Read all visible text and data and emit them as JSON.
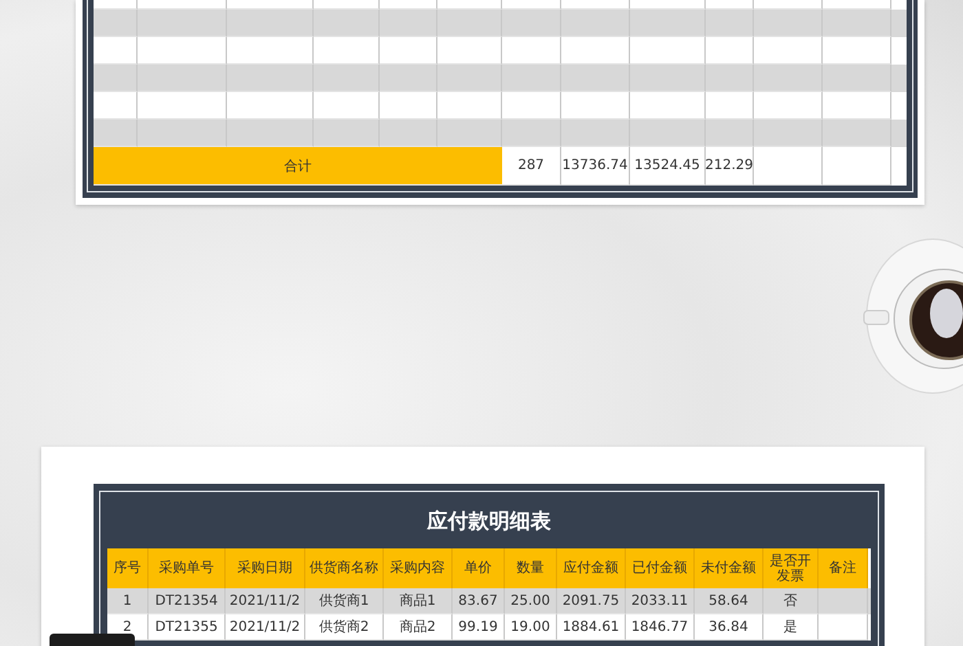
{
  "upper_sheet": {
    "rows": [
      {
        "shaded": false
      },
      {
        "shaded": true
      },
      {
        "shaded": false
      },
      {
        "shaded": true
      },
      {
        "shaded": false
      },
      {
        "shaded": true
      }
    ],
    "total_row": {
      "label": "合计",
      "values": [
        "287",
        "13736.74",
        "13524.45",
        "212.29"
      ]
    }
  },
  "lower_sheet": {
    "title": "应付款明细表",
    "columns": [
      "序号",
      "采购单号",
      "采购日期",
      "供货商名称",
      "采购内容",
      "单价",
      "数量",
      "应付金额",
      "已付金额",
      "未付金额",
      "是否开发票",
      "备注"
    ],
    "rows": [
      {
        "shaded": true,
        "cells": [
          "1",
          "DT21354",
          "2021/11/2",
          "供货商1",
          "商品1",
          "83.67",
          "25.00",
          "2091.75",
          "2033.11",
          "58.64",
          "否"
        ]
      },
      {
        "shaded": false,
        "cells": [
          "2",
          "DT21355",
          "2021/11/2",
          "供货商2",
          "商品2",
          "99.19",
          "19.00",
          "1884.61",
          "1846.77",
          "36.84",
          "是"
        ]
      }
    ]
  }
}
